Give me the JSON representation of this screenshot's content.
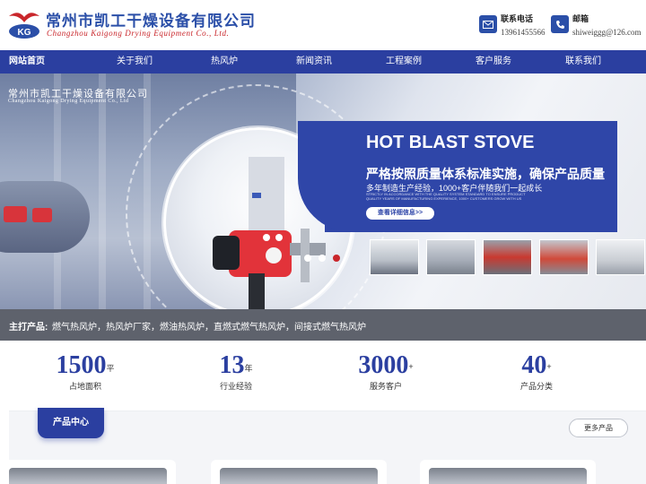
{
  "header": {
    "company_cn": "常州市凯工干燥设备有限公司",
    "company_en": "Changzhou Kaigong Drying Equipment Co., Ltd.",
    "logo_letters": "KG",
    "phone_label": "联系电话",
    "phone_value": "13961455566",
    "email_label": "邮箱",
    "email_value": "shiweiggg@126.com"
  },
  "nav": {
    "items": [
      "网站首页",
      "关于我们",
      "热风炉",
      "新闻资讯",
      "工程案例",
      "客户服务",
      "联系我们"
    ]
  },
  "banner": {
    "overlay_company_cn": "常州市凯工干燥设备有限公司",
    "overlay_company_en": "Changzhou Kaigong Drying Equipment Co., Ltd",
    "title": "HOT BLAST STOVE",
    "subtitle": "严格按照质量体系标准实施，确保产品质量",
    "subtitle2": "多年制造生产经验，1000+客户伴随我们一起成长",
    "tiny_text": "STRICTLY IN ACCORDANCE WITH THE QUALITY SYSTEM STANDARD TO ENSURE PRODUCT QUALITY YEARS OF MANUFACTURING EXPERIENCE, 1000+ CUSTOMERS GROW WITH US",
    "button_label": "查看详细信息>>",
    "active_slide": 3,
    "slide_count": 3
  },
  "products_bar": {
    "label": "主打产品:",
    "value": "燃气热风炉，热风炉厂家，燃油热风炉，直燃式燃气热风炉，间接式燃气热风炉"
  },
  "stats": [
    {
      "value": "1500",
      "unit": "平",
      "caption": "占地面积"
    },
    {
      "value": "13",
      "unit": "年",
      "caption": "行业经验"
    },
    {
      "value": "3000",
      "unit": "+",
      "caption": "服务客户"
    },
    {
      "value": "40",
      "unit": "+",
      "caption": "产品分类"
    }
  ],
  "product_center": {
    "tab_label": "产品中心",
    "more_label": "更多产品"
  },
  "colors": {
    "brand_blue": "#2b3fa0",
    "accent_red": "#c9262b",
    "bar_gray": "#5e626c"
  }
}
